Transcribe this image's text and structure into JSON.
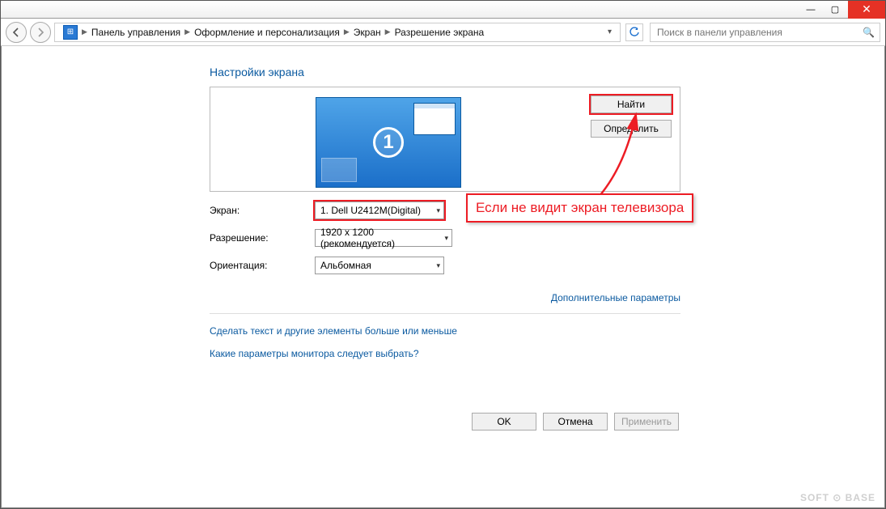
{
  "titlebar": {
    "minimize": "—",
    "maximize": "▢",
    "close": "✕"
  },
  "breadcrumb": {
    "items": [
      "Панель управления",
      "Оформление и персонализация",
      "Экран",
      "Разрешение экрана"
    ]
  },
  "search": {
    "placeholder": "Поиск в панели управления"
  },
  "heading": "Настройки экрана",
  "preview": {
    "monitor_number": "1"
  },
  "buttons": {
    "detect": "Найти",
    "identify": "Определить",
    "ok": "OK",
    "cancel": "Отмена",
    "apply": "Применить"
  },
  "form": {
    "display_label": "Экран:",
    "display_value": "1. Dell U2412M(Digital)",
    "resolution_label": "Разрешение:",
    "resolution_value": "1920 x 1200 (рекомендуется)",
    "orientation_label": "Ориентация:",
    "orientation_value": "Альбомная"
  },
  "links": {
    "advanced": "Дополнительные параметры",
    "text_size": "Сделать текст и другие элементы больше или меньше",
    "which_settings": "Какие параметры монитора следует выбрать?"
  },
  "annotation": "Если не видит экран телевизора",
  "watermark": "SOFT ⊙ BASE"
}
